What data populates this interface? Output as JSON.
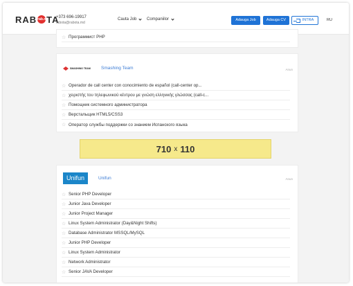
{
  "header": {
    "logo_left": "RAB",
    "logo_badge": "rab.md",
    "logo_right": "TA",
    "phone": "+373 696-19917",
    "email": "rabota@rabota.md",
    "nav": [
      {
        "label": "Cauta Job"
      },
      {
        "label": "Companiilor"
      }
    ],
    "add_job_label": "Adauga Job",
    "add_cv_label": "Adauga CV",
    "login_label": "INTRA",
    "lang": "RU"
  },
  "top_card": {
    "jobs": [
      {
        "title": "Программист PHP"
      }
    ]
  },
  "smashing": {
    "company": "Smashing Team",
    "logo_text": "SMASHING TEAM",
    "ad": "Anun",
    "jobs": [
      {
        "title": "Operador de call center con conocimiento de español (call-center op..."
      },
      {
        "title": "χειριστής του τηλεφωνικού κέντρου με γνώση ελληνικής γλώσσας (call-c..."
      },
      {
        "title": "Помощник системного администратора"
      },
      {
        "title": "Верстальщик HTML5/CSS3"
      },
      {
        "title": "Оператор службы поддержки со знанием Испанского языка"
      }
    ]
  },
  "banner": {
    "width": "710",
    "x": "x",
    "height": "110"
  },
  "unifun": {
    "company": "Unifun",
    "logo_text": "Unifun",
    "ad": "Anun",
    "jobs": [
      {
        "title": "Senior PHP Developer"
      },
      {
        "title": "Junior Java Developer"
      },
      {
        "title": "Junior Project Manager"
      },
      {
        "title": "Linux System Administrator (Day&Night Shifts)"
      },
      {
        "title": "Database Administrator MSSQL/MySQL"
      },
      {
        "title": "Junior PHP Developer"
      },
      {
        "title": "Linux System Administrator"
      },
      {
        "title": "Network Administrator"
      },
      {
        "title": "Senior JAVA Developer"
      }
    ]
  },
  "colors": {
    "accent": "#1f73d6",
    "logo_red": "#e2302e",
    "banner_bg": "#f6e98b"
  }
}
